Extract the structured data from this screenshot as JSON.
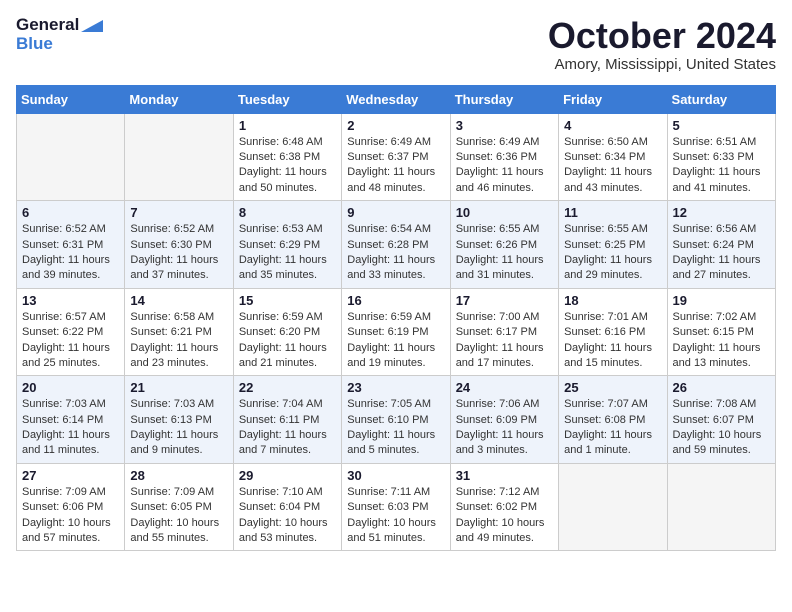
{
  "header": {
    "logo_line1": "General",
    "logo_line2": "Blue",
    "month": "October 2024",
    "location": "Amory, Mississippi, United States"
  },
  "days_of_week": [
    "Sunday",
    "Monday",
    "Tuesday",
    "Wednesday",
    "Thursday",
    "Friday",
    "Saturday"
  ],
  "weeks": [
    [
      {
        "day": "",
        "empty": true
      },
      {
        "day": "",
        "empty": true
      },
      {
        "day": "1",
        "sunrise": "6:48 AM",
        "sunset": "6:38 PM",
        "daylight": "11 hours and 50 minutes."
      },
      {
        "day": "2",
        "sunrise": "6:49 AM",
        "sunset": "6:37 PM",
        "daylight": "11 hours and 48 minutes."
      },
      {
        "day": "3",
        "sunrise": "6:49 AM",
        "sunset": "6:36 PM",
        "daylight": "11 hours and 46 minutes."
      },
      {
        "day": "4",
        "sunrise": "6:50 AM",
        "sunset": "6:34 PM",
        "daylight": "11 hours and 43 minutes."
      },
      {
        "day": "5",
        "sunrise": "6:51 AM",
        "sunset": "6:33 PM",
        "daylight": "11 hours and 41 minutes."
      }
    ],
    [
      {
        "day": "6",
        "sunrise": "6:52 AM",
        "sunset": "6:31 PM",
        "daylight": "11 hours and 39 minutes."
      },
      {
        "day": "7",
        "sunrise": "6:52 AM",
        "sunset": "6:30 PM",
        "daylight": "11 hours and 37 minutes."
      },
      {
        "day": "8",
        "sunrise": "6:53 AM",
        "sunset": "6:29 PM",
        "daylight": "11 hours and 35 minutes."
      },
      {
        "day": "9",
        "sunrise": "6:54 AM",
        "sunset": "6:28 PM",
        "daylight": "11 hours and 33 minutes."
      },
      {
        "day": "10",
        "sunrise": "6:55 AM",
        "sunset": "6:26 PM",
        "daylight": "11 hours and 31 minutes."
      },
      {
        "day": "11",
        "sunrise": "6:55 AM",
        "sunset": "6:25 PM",
        "daylight": "11 hours and 29 minutes."
      },
      {
        "day": "12",
        "sunrise": "6:56 AM",
        "sunset": "6:24 PM",
        "daylight": "11 hours and 27 minutes."
      }
    ],
    [
      {
        "day": "13",
        "sunrise": "6:57 AM",
        "sunset": "6:22 PM",
        "daylight": "11 hours and 25 minutes."
      },
      {
        "day": "14",
        "sunrise": "6:58 AM",
        "sunset": "6:21 PM",
        "daylight": "11 hours and 23 minutes."
      },
      {
        "day": "15",
        "sunrise": "6:59 AM",
        "sunset": "6:20 PM",
        "daylight": "11 hours and 21 minutes."
      },
      {
        "day": "16",
        "sunrise": "6:59 AM",
        "sunset": "6:19 PM",
        "daylight": "11 hours and 19 minutes."
      },
      {
        "day": "17",
        "sunrise": "7:00 AM",
        "sunset": "6:17 PM",
        "daylight": "11 hours and 17 minutes."
      },
      {
        "day": "18",
        "sunrise": "7:01 AM",
        "sunset": "6:16 PM",
        "daylight": "11 hours and 15 minutes."
      },
      {
        "day": "19",
        "sunrise": "7:02 AM",
        "sunset": "6:15 PM",
        "daylight": "11 hours and 13 minutes."
      }
    ],
    [
      {
        "day": "20",
        "sunrise": "7:03 AM",
        "sunset": "6:14 PM",
        "daylight": "11 hours and 11 minutes."
      },
      {
        "day": "21",
        "sunrise": "7:03 AM",
        "sunset": "6:13 PM",
        "daylight": "11 hours and 9 minutes."
      },
      {
        "day": "22",
        "sunrise": "7:04 AM",
        "sunset": "6:11 PM",
        "daylight": "11 hours and 7 minutes."
      },
      {
        "day": "23",
        "sunrise": "7:05 AM",
        "sunset": "6:10 PM",
        "daylight": "11 hours and 5 minutes."
      },
      {
        "day": "24",
        "sunrise": "7:06 AM",
        "sunset": "6:09 PM",
        "daylight": "11 hours and 3 minutes."
      },
      {
        "day": "25",
        "sunrise": "7:07 AM",
        "sunset": "6:08 PM",
        "daylight": "11 hours and 1 minute."
      },
      {
        "day": "26",
        "sunrise": "7:08 AM",
        "sunset": "6:07 PM",
        "daylight": "10 hours and 59 minutes."
      }
    ],
    [
      {
        "day": "27",
        "sunrise": "7:09 AM",
        "sunset": "6:06 PM",
        "daylight": "10 hours and 57 minutes."
      },
      {
        "day": "28",
        "sunrise": "7:09 AM",
        "sunset": "6:05 PM",
        "daylight": "10 hours and 55 minutes."
      },
      {
        "day": "29",
        "sunrise": "7:10 AM",
        "sunset": "6:04 PM",
        "daylight": "10 hours and 53 minutes."
      },
      {
        "day": "30",
        "sunrise": "7:11 AM",
        "sunset": "6:03 PM",
        "daylight": "10 hours and 51 minutes."
      },
      {
        "day": "31",
        "sunrise": "7:12 AM",
        "sunset": "6:02 PM",
        "daylight": "10 hours and 49 minutes."
      },
      {
        "day": "",
        "empty": true
      },
      {
        "day": "",
        "empty": true
      }
    ]
  ]
}
